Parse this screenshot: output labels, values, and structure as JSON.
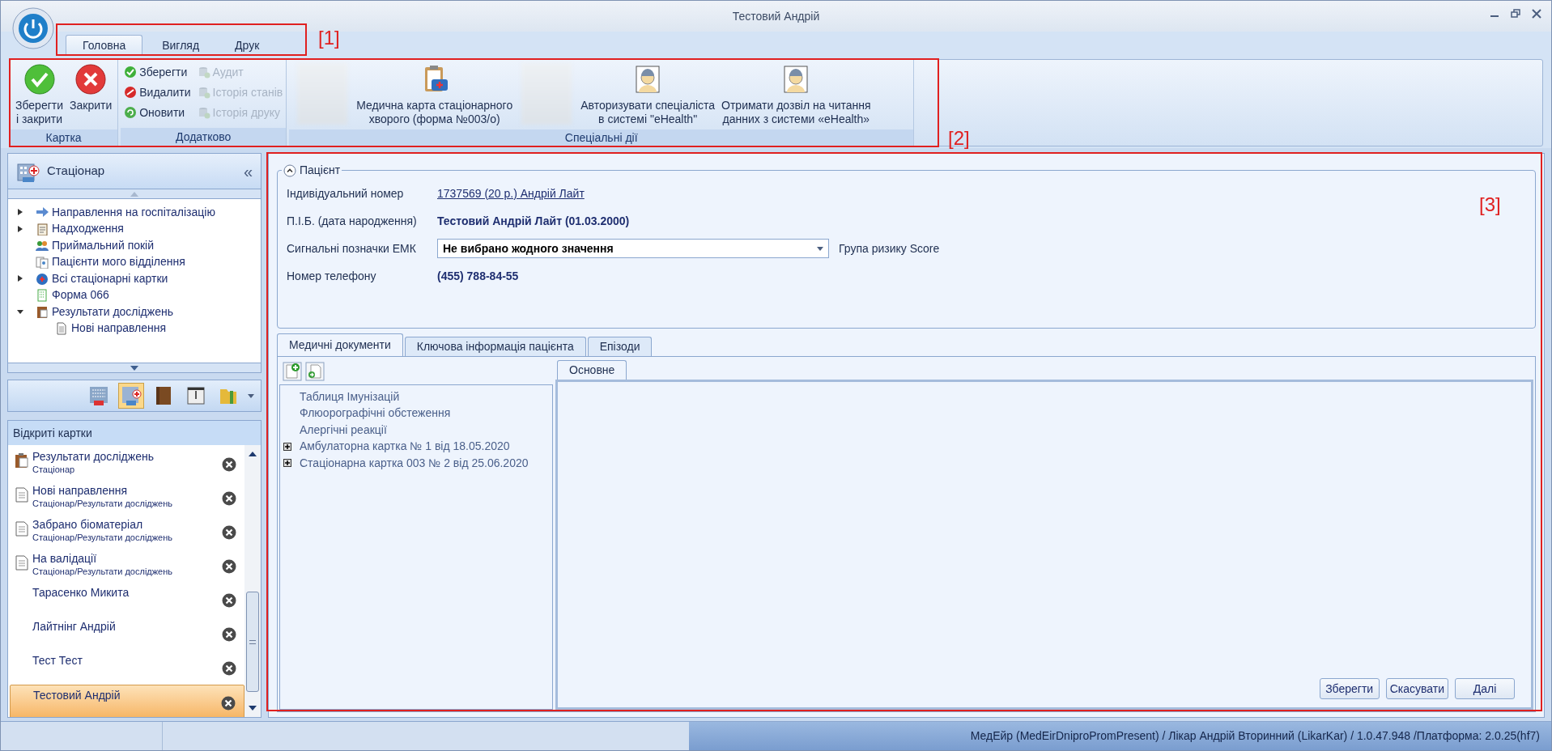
{
  "window": {
    "title": "Тестовий Андрій"
  },
  "ribbon_tabs": [
    {
      "label": "Головна",
      "selected": true
    },
    {
      "label": "Вигляд",
      "selected": false
    },
    {
      "label": "Друк",
      "selected": false
    }
  ],
  "ribbon_groups": [
    {
      "label": "Картка",
      "items": [
        {
          "kind": "large",
          "label": "Зберегти\nі закрити"
        },
        {
          "kind": "large",
          "label": "Закрити"
        }
      ]
    },
    {
      "label": "Додатково",
      "items": [
        {
          "kind": "small",
          "label": "Зберегти",
          "disabled": false
        },
        {
          "kind": "small",
          "label": "Видалити",
          "disabled": false
        },
        {
          "kind": "small",
          "label": "Оновити",
          "disabled": false
        },
        {
          "kind": "small",
          "label": "Аудит",
          "disabled": true
        },
        {
          "kind": "small",
          "label": "Історія станів",
          "disabled": true
        },
        {
          "kind": "small",
          "label": "Історія друку",
          "disabled": true
        }
      ]
    },
    {
      "label": "Спеціальні дії",
      "items": [
        {
          "kind": "blurred"
        },
        {
          "kind": "large",
          "label": "Медична карта стаціонарного\nхворого (форма №003/о)"
        },
        {
          "kind": "blurred"
        },
        {
          "kind": "large",
          "label": "Авторизувати спеціаліста\nв системі \"eHealth\""
        },
        {
          "kind": "large",
          "label": "Отримати дозвіл на читання\nданних з системи «eHealth»"
        }
      ]
    }
  ],
  "navigation": {
    "title": "Стаціонар",
    "collapse_glyph": "«",
    "tree": [
      {
        "label": "Направлення на госпіталізацію",
        "kind": "folder",
        "expanded": false
      },
      {
        "label": "Надходження",
        "kind": "folder",
        "expanded": false
      },
      {
        "label": "Приймальний покій",
        "kind": "leaf"
      },
      {
        "label": "Пацієнти мого відділення",
        "kind": "leaf"
      },
      {
        "label": "Всі стаціонарні картки",
        "kind": "folder",
        "expanded": false
      },
      {
        "label": "Форма 066",
        "kind": "leaf"
      },
      {
        "label": "Результати досліджень",
        "kind": "folder",
        "expanded": true,
        "children": [
          {
            "label": "Нові направлення",
            "kind": "leaf"
          }
        ]
      }
    ],
    "modules": [
      {
        "selected": false
      },
      {
        "selected": true
      },
      {
        "selected": false
      },
      {
        "selected": false
      },
      {
        "selected": false
      }
    ]
  },
  "open_cards": {
    "title": "Відкриті картки",
    "items": [
      {
        "title": "Результати досліджень",
        "path": "Стаціонар",
        "selected": false
      },
      {
        "title": "Нові направлення",
        "path": "Стаціонар/Результати досліджень",
        "selected": false
      },
      {
        "title": "Забрано біоматеріал",
        "path": "Стаціонар/Результати досліджень",
        "selected": false
      },
      {
        "title": "На валідації",
        "path": "Стаціонар/Результати досліджень",
        "selected": false
      },
      {
        "title": "Тарасенко Микита",
        "selected": false
      },
      {
        "title": "Лайтнінг Андрій",
        "selected": false
      },
      {
        "title": "Тест Тест",
        "selected": false
      },
      {
        "title": "Тестовий Андрій",
        "selected": true
      }
    ]
  },
  "patient": {
    "title": "Пацієнт",
    "expanded": true,
    "fields": [
      {
        "label": "Індивідуальний номер",
        "kind": "link",
        "value": "1737569 (20 р.) Андрій Лайт"
      },
      {
        "label": "П.І.Б. (дата народження)",
        "kind": "bold",
        "value": "Тестовий Андрій Лайт (01.03.2000)"
      },
      {
        "label": "Сигнальні позначки ЕМК",
        "kind": "combo",
        "value": "Не вибрано жодного значення",
        "note": "Група ризику Score"
      },
      {
        "label": "Номер телефону",
        "kind": "bold",
        "value": "(455) 788-84-55"
      }
    ]
  },
  "document_tabs": [
    {
      "label": "Медичні документи",
      "selected": true
    },
    {
      "label": "Ключова інформація пацієнта",
      "selected": false
    },
    {
      "label": "Епізоди",
      "selected": false
    }
  ],
  "documents": [
    {
      "label": "Таблиця Імунізацій",
      "kind": "leaf"
    },
    {
      "label": "Флюорографічні обстеження",
      "kind": "leaf"
    },
    {
      "label": "Алергічні реакції",
      "kind": "leaf"
    },
    {
      "label": "Амбулаторна картка № 1 від 18.05.2020",
      "kind": "folder",
      "expanded": false
    },
    {
      "label": "Стаціонарна картка 003 № 2 від 25.06.2020",
      "kind": "folder",
      "expanded": false
    }
  ],
  "detail_tabs": [
    {
      "label": "Основне",
      "selected": true
    }
  ],
  "buttons": [
    "Зберегти",
    "Скасувати",
    "Далі"
  ],
  "status_bar": {
    "text": "МедЕйр (MedEirDniproPromPresent) / Лікар Андрій Вторинний (LikarKar) / 1.0.47.948 /Платформа: 2.0.25(hf7)"
  },
  "annotations": [
    "[1]",
    "[2]",
    "[3]"
  ]
}
